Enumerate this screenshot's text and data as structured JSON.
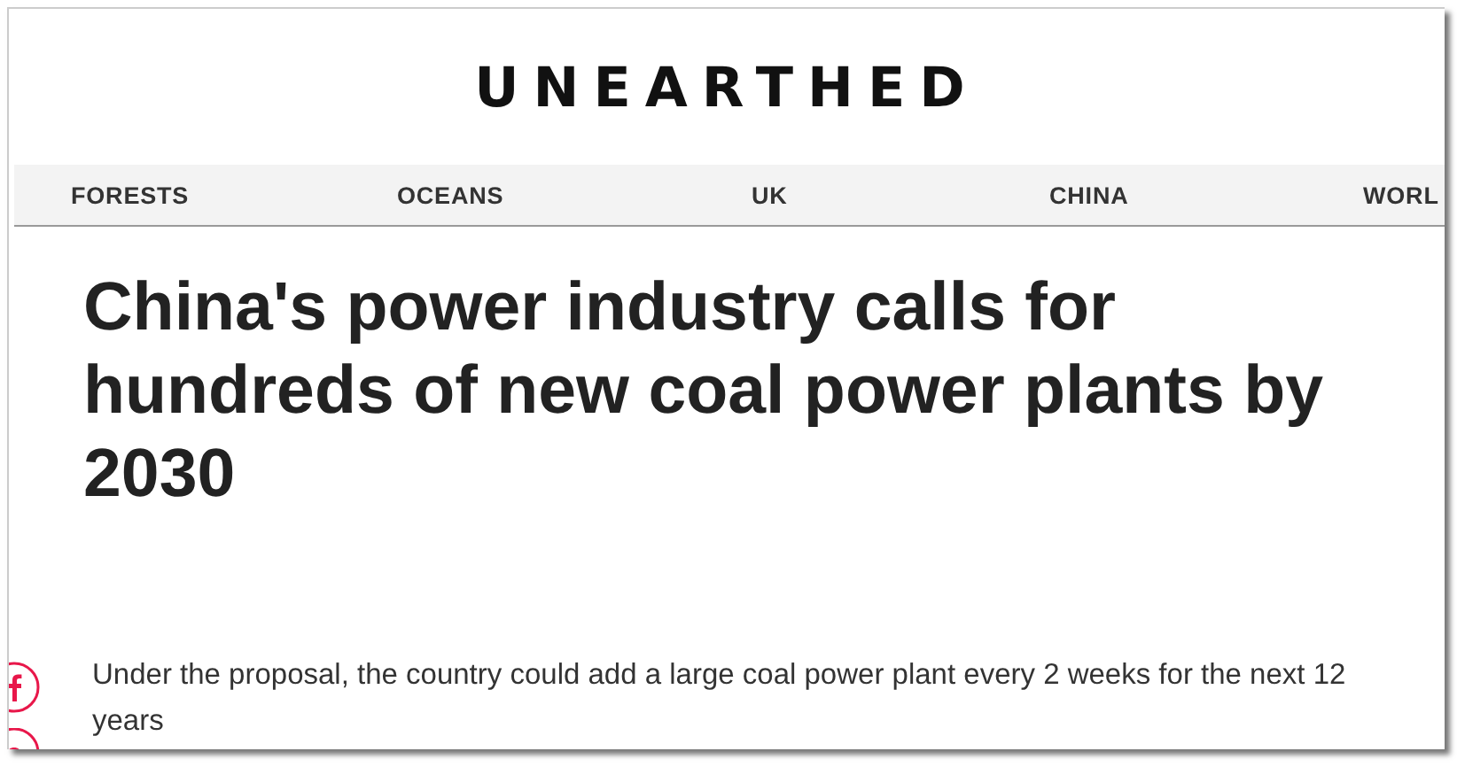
{
  "logo": "UNEARTHED",
  "nav": [
    {
      "label": "FORESTS"
    },
    {
      "label": "OCEANS"
    },
    {
      "label": "UK"
    },
    {
      "label": "CHINA"
    },
    {
      "label": "WORL"
    }
  ],
  "headline": "China's power industry calls for hundreds of new coal power plants by 2030",
  "standfirst": "Under the proposal, the country could add a large coal power plant every 2 weeks for the next 12 years"
}
